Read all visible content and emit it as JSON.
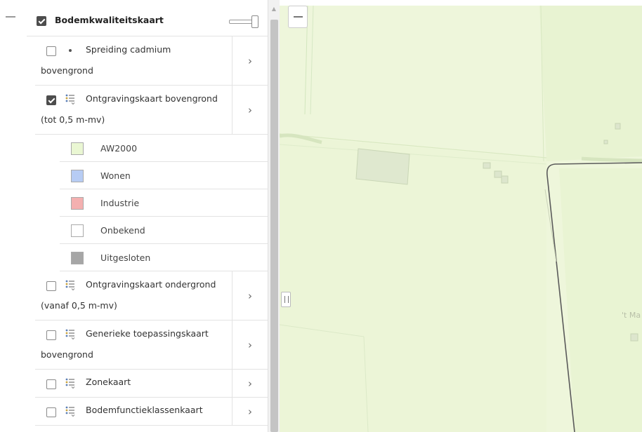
{
  "group": {
    "title": "Bodemkwaliteitskaart",
    "checked": true
  },
  "layers": [
    {
      "line1": "Spreiding cadmium",
      "line2": "bovengrond",
      "checked": false,
      "icon": "dot-icon"
    },
    {
      "line1": "Ontgravingskaart bovengrond",
      "line2": "(tot 0,5 m-mv)",
      "checked": true,
      "icon": "legend-list-icon"
    },
    {
      "line1": "Ontgravingskaart ondergrond",
      "line2": "(vanaf 0,5 m-mv)",
      "checked": false,
      "icon": "legend-list-icon"
    },
    {
      "line1": "Generieke toepassingskaart",
      "line2": "bovengrond",
      "checked": false,
      "icon": "legend-list-icon"
    },
    {
      "single": "Zonekaart",
      "checked": false,
      "icon": "legend-list-icon"
    },
    {
      "single": "Bodemfunctieklassenkaart",
      "checked": false,
      "icon": "legend-list-icon"
    }
  ],
  "legend": [
    {
      "label": "AW2000",
      "color": "#eaf7d3"
    },
    {
      "label": "Wonen",
      "color": "#b7ccf4"
    },
    {
      "label": "Industrie",
      "color": "#f4b0b0"
    },
    {
      "label": "Onbekend",
      "color": "#ffffff"
    },
    {
      "label": "Uitgesloten",
      "color": "#a6a6a6"
    }
  ],
  "arrow_glyph": "›",
  "map": {
    "place_label": "'t Ma",
    "background": "#eef6db"
  }
}
